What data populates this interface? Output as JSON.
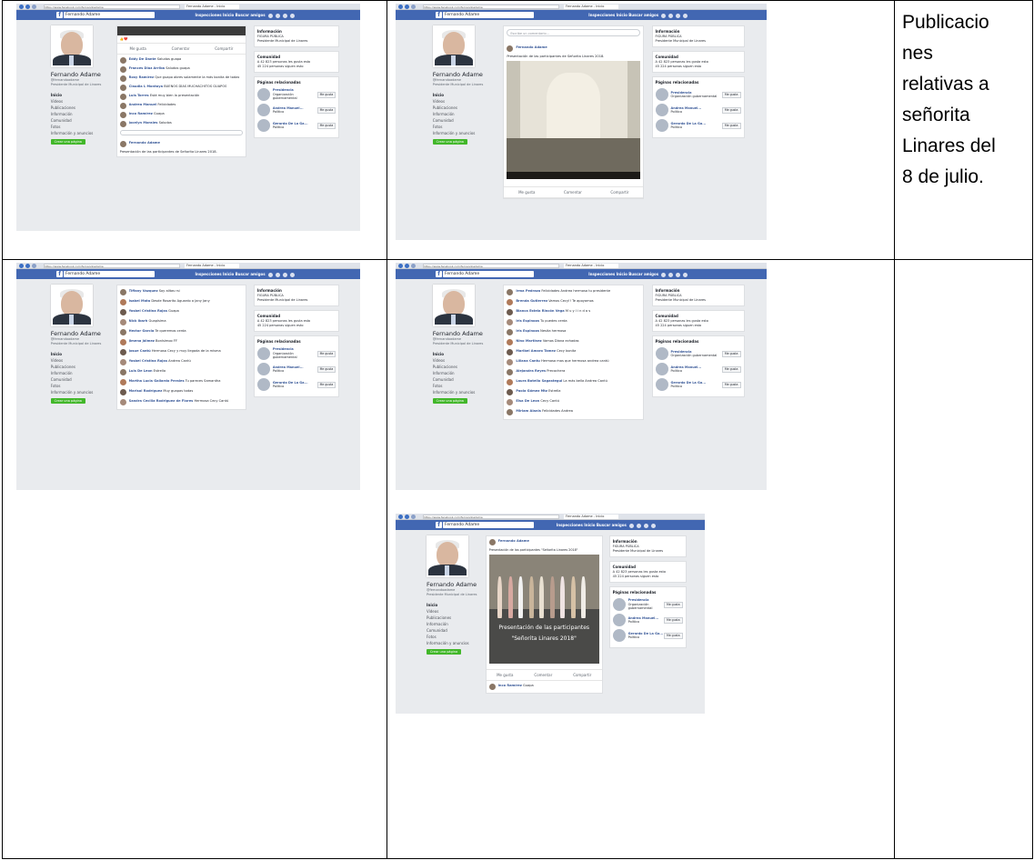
{
  "description_lines": [
    "Publicacio",
    "nes",
    "relativas  a",
    "señorita",
    "Linares del",
    "8 de julio."
  ],
  "screenshots": [
    {
      "id": "s1",
      "url": "https://www.facebook.com/fernandoadame",
      "tab": "Fernando Adame - Inicio",
      "search": "Fernando Adame",
      "nav": "Inspecciones   Inicio   Buscar amigos",
      "profile_name": "Fernando Adame",
      "profile_sub": "@fernandoadame",
      "profile_role": "Presidente Municipal de Linares",
      "menu": [
        "Inicio",
        "Videos",
        "Publicaciones",
        "Información",
        "Comunidad",
        "Fotos",
        "Información y anuncios"
      ],
      "create_page": "Crear una página",
      "post_author": "Fernando Adame",
      "post_title": "Presentación de las participantes de Señorita Linares 2018.",
      "buttons": [
        "Me gusta",
        "Comentar",
        "Compartir"
      ],
      "comments": [
        {
          "name": "Eddy De Dante",
          "text": "Saludos guapa"
        },
        {
          "name": "Frances Diaz Arriba",
          "text": "Saludos guapa"
        },
        {
          "name": "Rosy Ramírez",
          "text": "Que guapo abres solamente la más bonita de todas"
        },
        {
          "name": "Claudia L Montoya",
          "text": "BUENOS DÍAS MUCHACHITOS GUAPOS"
        },
        {
          "name": "Luis Torres",
          "text": "Está muy bien la presentación"
        },
        {
          "name": "Andrea Manuel",
          "text": "Felicidades"
        },
        {
          "name": "Inco Ramírez",
          "text": "Guapa"
        },
        {
          "name": "Jocelyn Morales",
          "text": "Saludos"
        }
      ],
      "info_title": "Información",
      "info_type": "FIGURA PÚBLICA",
      "info_role": "Presidente Municipal de Linares",
      "community_title": "Comunidad",
      "community": [
        "A 42 823 personas les gusta esto",
        "45 224 personas siguen esto"
      ],
      "pages_title": "Páginas relacionadas",
      "related": [
        {
          "name": "Presidencia",
          "sub": "Organización gubernamental",
          "btn": "Me gusta"
        },
        {
          "name": "Andrea Manuel...",
          "sub": "Político",
          "btn": "Me gusta"
        },
        {
          "name": "Gerardo De La Ga...",
          "sub": "Político",
          "btn": "Me gusta"
        }
      ]
    },
    {
      "id": "s2",
      "url": "https://www.facebook.com/fernandoadame",
      "tab": "Fernando Adame - Inicio",
      "search": "Fernando Adame",
      "nav": "Inspecciones   Inicio   Buscar amigos",
      "profile_name": "Fernando Adame",
      "profile_sub": "@fernandoadame",
      "profile_role": "Presidente Municipal de Linares",
      "menu": [
        "Inicio",
        "Videos",
        "Publicaciones",
        "Información",
        "Comunidad",
        "Fotos",
        "Información y anuncios"
      ],
      "create_page": "Crear una página",
      "post_author": "Fernando Adame",
      "post_title": "Presentación de las participantes de Señorita Linares 2018.",
      "buttons": [
        "Me gusta",
        "Comentar",
        "Compartir"
      ],
      "comment_placeholder": "Escribe un comentario...",
      "info_title": "Información",
      "info_type": "FIGURA PÚBLICA",
      "info_role": "Presidente Municipal de Linares",
      "community_title": "Comunidad",
      "community": [
        "A 42 823 personas les gusta esto",
        "45 224 personas siguen esto"
      ],
      "pages_title": "Páginas relacionadas",
      "related": [
        {
          "name": "Presidencia",
          "sub": "Organización gubernamental",
          "btn": "Me gusta"
        },
        {
          "name": "Andrea Manuel...",
          "sub": "Político",
          "btn": "Me gusta"
        },
        {
          "name": "Gerardo De La Ga...",
          "sub": "Político",
          "btn": "Me gusta"
        }
      ]
    },
    {
      "id": "s3",
      "url": "https://www.facebook.com/fernandoadame",
      "tab": "Fernando Adame - Inicio",
      "search": "Fernando Adame",
      "nav": "Inspecciones   Inicio   Buscar amigos",
      "profile_name": "Fernando Adame",
      "profile_sub": "@fernandoadame",
      "profile_role": "Presidente Municipal de Linares",
      "menu": [
        "Inicio",
        "Videos",
        "Publicaciones",
        "Información",
        "Comunidad",
        "Fotos",
        "Información y anuncios"
      ],
      "create_page": "Crear una página",
      "comments": [
        {
          "name": "Tiffany Vazquez",
          "text": "Soy alitas rsi"
        },
        {
          "name": "Isabel Mata",
          "text": "Desde Rosarito Aguardo a Jany Jany"
        },
        {
          "name": "Yosbel Cristina Rojas",
          "text": "Guapa"
        },
        {
          "name": "Nick Ibarh",
          "text": "Guapísima"
        },
        {
          "name": "Hector Garcia",
          "text": "Te queremos cerda"
        },
        {
          "name": "Jimena Jáimez",
          "text": "Bonísimoo FF"
        },
        {
          "name": "Josue Cantú",
          "text": "Hermosa Cecy y muy llegada de la misma"
        },
        {
          "name": "Yosbel Cristina Rojas",
          "text": "Andrea Cantú"
        },
        {
          "name": "Luis De Leon",
          "text": "Estrella"
        },
        {
          "name": "Martha Lucia Gallardo Perales",
          "text": "Tu pareces Samantha"
        },
        {
          "name": "Marisol Rodríguez",
          "text": "Muy guapas todas"
        },
        {
          "name": "Sandra Cecilia Rodriguez de Flores",
          "text": "Hermosa Cecy Cantú"
        }
      ],
      "info_title": "Información",
      "info_type": "FIGURA PÚBLICA",
      "info_role": "Presidente Municipal de Linares",
      "community_title": "Comunidad",
      "community": [
        "A 42 823 personas les gusta esto",
        "45 224 personas siguen esto"
      ],
      "pages_title": "Páginas relacionadas",
      "related": [
        {
          "name": "Presidencia",
          "sub": "Organización gubernamental",
          "btn": "Me gusta"
        },
        {
          "name": "Andrea Manuel...",
          "sub": "Político",
          "btn": "Me gusta"
        },
        {
          "name": "Gerardo De La Ga...",
          "sub": "Político",
          "btn": "Me gusta"
        }
      ]
    },
    {
      "id": "s4",
      "url": "https://www.facebook.com/fernandoadame",
      "tab": "Fernando Adame - Inicio",
      "search": "Fernando Adame",
      "nav": "Inspecciones   Inicio   Buscar amigos",
      "profile_name": "Fernando Adame",
      "profile_sub": "@fernandoadame",
      "profile_role": "Presidente Municipal de Linares",
      "menu": [
        "Inicio",
        "Videos",
        "Publicaciones",
        "Información",
        "Comunidad",
        "Fotos",
        "Información y anuncios"
      ],
      "create_page": "Crear una página",
      "comments": [
        {
          "name": "Irma Pedraza",
          "text": "Felicidades Andrea hermosa tu presidente"
        },
        {
          "name": "Brenda Gutierrez",
          "text": "Vamos Cecy!! Te apoyamos"
        },
        {
          "name": "Blanca Estela Rincón Vega",
          "text": "M u y l i n d a s"
        },
        {
          "name": "Iris Espinoza",
          "text": "Tu puedes cerda"
        },
        {
          "name": "Iris Espinoza",
          "text": "Nesita hermosa"
        },
        {
          "name": "Nino Martinez",
          "text": "Vamos Diana echadas"
        },
        {
          "name": "Maribel Amaro Tamez",
          "text": "Cecy bonita"
        },
        {
          "name": "Liliana Cantu",
          "text": "Hermosa mas que hermosa andrea cantú"
        },
        {
          "name": "Alejandra Reyes",
          "text": "Precochera"
        },
        {
          "name": "Laura Botello Sagastegui",
          "text": "La más bella Andrea Cantú"
        },
        {
          "name": "Paola Gómez Mtz",
          "text": "Estrella"
        },
        {
          "name": "Elsa De Leon",
          "text": "Cecy Cantú"
        },
        {
          "name": "Miriam Alanis",
          "text": "Felicidades Andrea"
        }
      ],
      "info_title": "Información",
      "info_type": "FIGURA PÚBLICA",
      "info_role": "Presidente Municipal de Linares",
      "community_title": "Comunidad",
      "community": [
        "A 42 823 personas les gusta esto",
        "45 224 personas siguen esto"
      ],
      "pages_title": "Páginas relacionadas",
      "related": [
        {
          "name": "Presidencia",
          "sub": "Organización gubernamental",
          "btn": "Me gusta"
        },
        {
          "name": "Andrea Manuel...",
          "sub": "Político",
          "btn": "Me gusta"
        },
        {
          "name": "Gerardo De La Ga...",
          "sub": "Político",
          "btn": "Me gusta"
        }
      ]
    },
    {
      "id": "s5",
      "url": "https://www.facebook.com/fernandoadame",
      "tab": "Fernando Adame - Inicio",
      "search": "Fernando Adame",
      "nav": "Inspecciones   Inicio   Buscar amigos",
      "profile_name": "Fernando Adame",
      "profile_sub": "@fernandoadame",
      "profile_role": "Presidente Municipal de Linares",
      "menu": [
        "Inicio",
        "Videos",
        "Publicaciones",
        "Información",
        "Comunidad",
        "Fotos",
        "Información y anuncios"
      ],
      "create_page": "Crear una página",
      "post_author": "Fernando Adame",
      "post_title": "Presentación de las participantes \"Señorita Linares 2018\"",
      "photo_caption_1": "Presentación de las participantes",
      "photo_caption_2": "\"Señorita Linares 2018\"",
      "buttons": [
        "Me gusta",
        "Comentar",
        "Compartir"
      ],
      "comments": [
        {
          "name": "Inco Ramírez",
          "text": "Guapa"
        }
      ],
      "info_title": "Información",
      "info_type": "FIGURA PÚBLICA",
      "info_role": "Presidente Municipal de Linares",
      "community_title": "Comunidad",
      "community": [
        "A 42 823 personas les gusta esto",
        "45 224 personas siguen esto"
      ],
      "pages_title": "Páginas relacionadas",
      "related": [
        {
          "name": "Presidencia",
          "sub": "Organización gubernamental",
          "btn": "Me gusta"
        },
        {
          "name": "Andrea Manuel...",
          "sub": "Político",
          "btn": "Me gusta"
        },
        {
          "name": "Gerardo De La Ga...",
          "sub": "Político",
          "btn": "Me gusta"
        }
      ]
    }
  ]
}
